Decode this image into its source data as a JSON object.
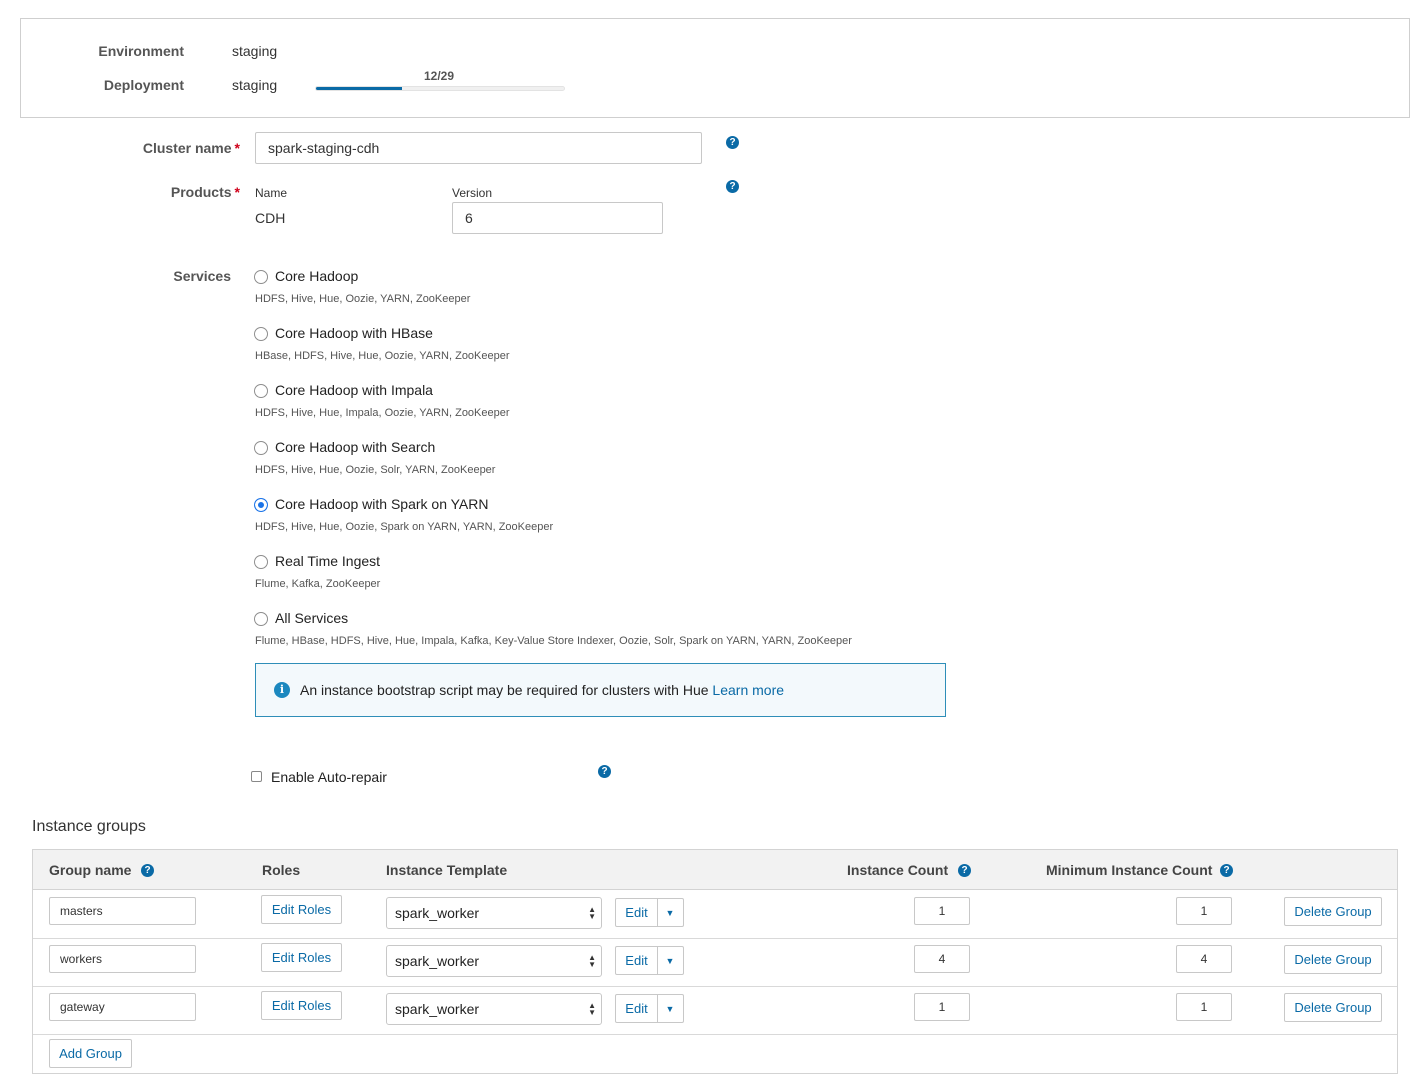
{
  "summary": {
    "environment_label": "Environment",
    "environment_value": "staging",
    "deployment_label": "Deployment",
    "deployment_value": "staging",
    "progress_text": "12/29",
    "progress_fraction": 0.348
  },
  "form": {
    "cluster_name_label": "Cluster name",
    "cluster_name_value": "spark-staging-cdh",
    "required_mark": "*",
    "products_label": "Products",
    "product_name_header": "Name",
    "product_version_header": "Version",
    "product_name": "CDH",
    "product_version": "6",
    "help_glyph": "?",
    "services_label": "Services",
    "services": [
      {
        "label": "Core Hadoop",
        "desc": "HDFS, Hive, Hue, Oozie, YARN, ZooKeeper",
        "checked": false
      },
      {
        "label": "Core Hadoop with HBase",
        "desc": "HBase, HDFS, Hive, Hue, Oozie, YARN, ZooKeeper",
        "checked": false
      },
      {
        "label": "Core Hadoop with Impala",
        "desc": "HDFS, Hive, Hue, Impala, Oozie, YARN, ZooKeeper",
        "checked": false
      },
      {
        "label": "Core Hadoop with Search",
        "desc": "HDFS, Hive, Hue, Oozie, Solr, YARN, ZooKeeper",
        "checked": false
      },
      {
        "label": "Core Hadoop with Spark on YARN",
        "desc": "HDFS, Hive, Hue, Oozie, Spark on YARN, YARN, ZooKeeper",
        "checked": true
      },
      {
        "label": "Real Time Ingest",
        "desc": "Flume, Kafka, ZooKeeper",
        "checked": false
      },
      {
        "label": "All Services",
        "desc": "Flume, HBase, HDFS, Hive, Hue, Impala, Kafka, Key-Value Store Indexer, Oozie, Solr, Spark on YARN, YARN, ZooKeeper",
        "checked": false
      }
    ],
    "info_glyph": "i",
    "info_text": "An instance bootstrap script may be required for clusters with Hue",
    "info_link": "Learn more",
    "auto_repair_label": "Enable Auto-repair",
    "auto_repair_checked": false
  },
  "instance_groups": {
    "title": "Instance groups",
    "headers": {
      "group_name": "Group name",
      "roles": "Roles",
      "template": "Instance Template",
      "count": "Instance Count",
      "min_count": "Minimum Instance Count"
    },
    "rows": [
      {
        "name": "masters",
        "roles_button": "Edit Roles",
        "template": "spark_worker",
        "edit": "Edit",
        "count": "1",
        "min_count": "1",
        "delete": "Delete Group"
      },
      {
        "name": "workers",
        "roles_button": "Edit Roles",
        "template": "spark_worker",
        "edit": "Edit",
        "count": "4",
        "min_count": "4",
        "delete": "Delete Group"
      },
      {
        "name": "gateway",
        "roles_button": "Edit Roles",
        "template": "spark_worker",
        "edit": "Edit",
        "count": "1",
        "min_count": "1",
        "delete": "Delete Group"
      }
    ],
    "add_group": "Add Group"
  },
  "icons": {
    "help": "question-circle-icon",
    "info": "info-circle-icon",
    "select_arrows": "updown-arrows-icon",
    "caret": "caret-down-icon"
  },
  "colors": {
    "accent": "#0a6aa6",
    "required": "#d0021b",
    "info_border": "#2e8eb8",
    "radio_selected": "#1a73e8"
  }
}
